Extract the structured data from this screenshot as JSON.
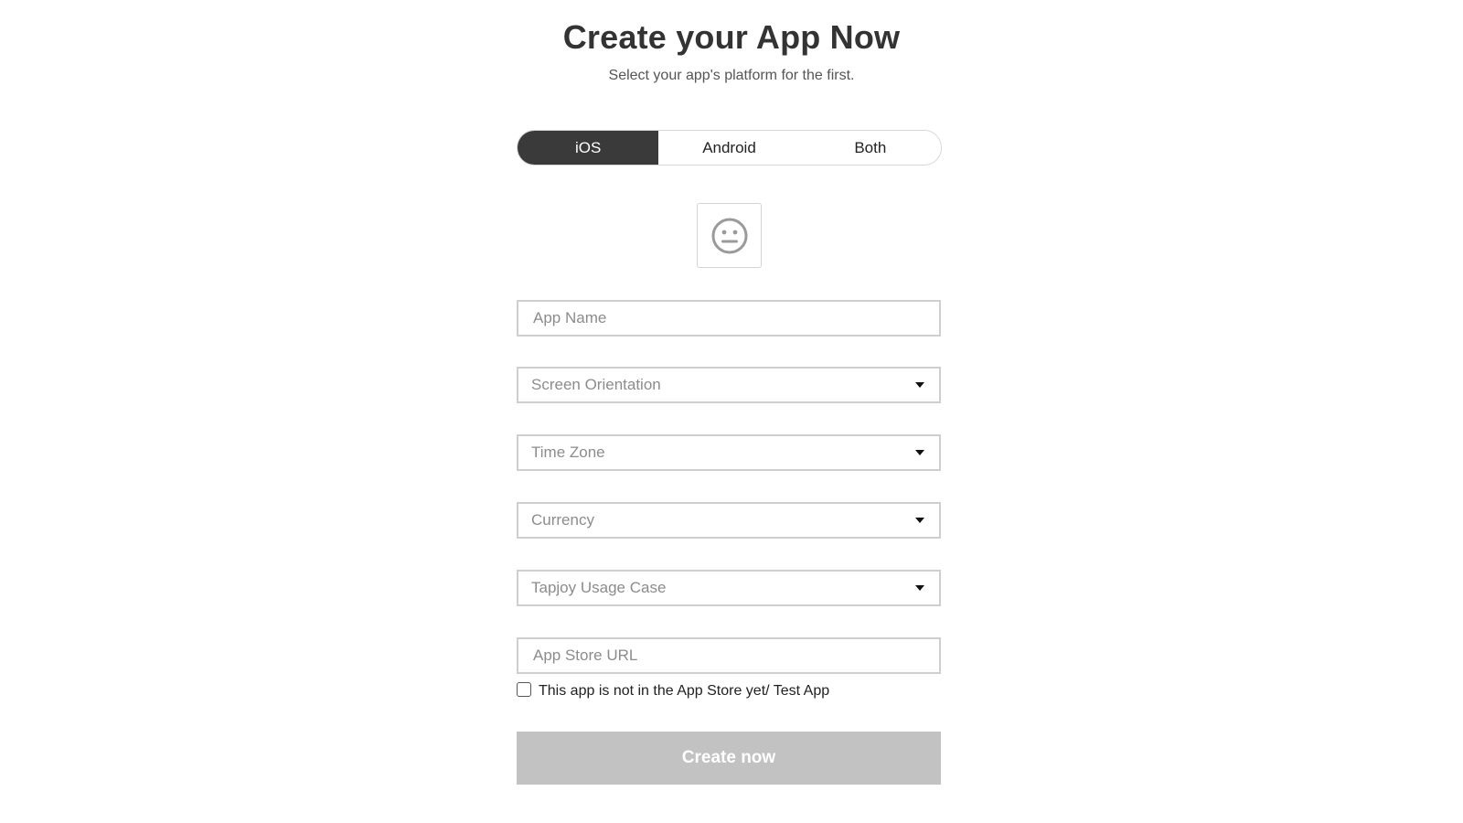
{
  "header": {
    "title": "Create your App Now",
    "subtitle": "Select your app's platform for the first."
  },
  "platform": {
    "options": [
      "iOS",
      "Android",
      "Both"
    ],
    "selected": "iOS"
  },
  "app_icon": {
    "icon": "neutral-face-icon"
  },
  "form": {
    "app_name": {
      "value": "",
      "placeholder": "App Name"
    },
    "screen_orientation": {
      "value": "Screen Orientation"
    },
    "time_zone": {
      "value": "Time Zone"
    },
    "currency": {
      "value": "Currency"
    },
    "usage_case": {
      "value": "Tapjoy Usage Case"
    },
    "app_store_url": {
      "value": "",
      "placeholder": "App Store URL"
    },
    "test_app_checkbox": {
      "label": "This app is not in the App Store yet/ Test App",
      "checked": false
    }
  },
  "actions": {
    "create_label": "Create now"
  },
  "colors": {
    "toggle_active": "#3a3a3a",
    "button_disabled": "#c2c2c2",
    "field_border": "#cfcfcf"
  }
}
